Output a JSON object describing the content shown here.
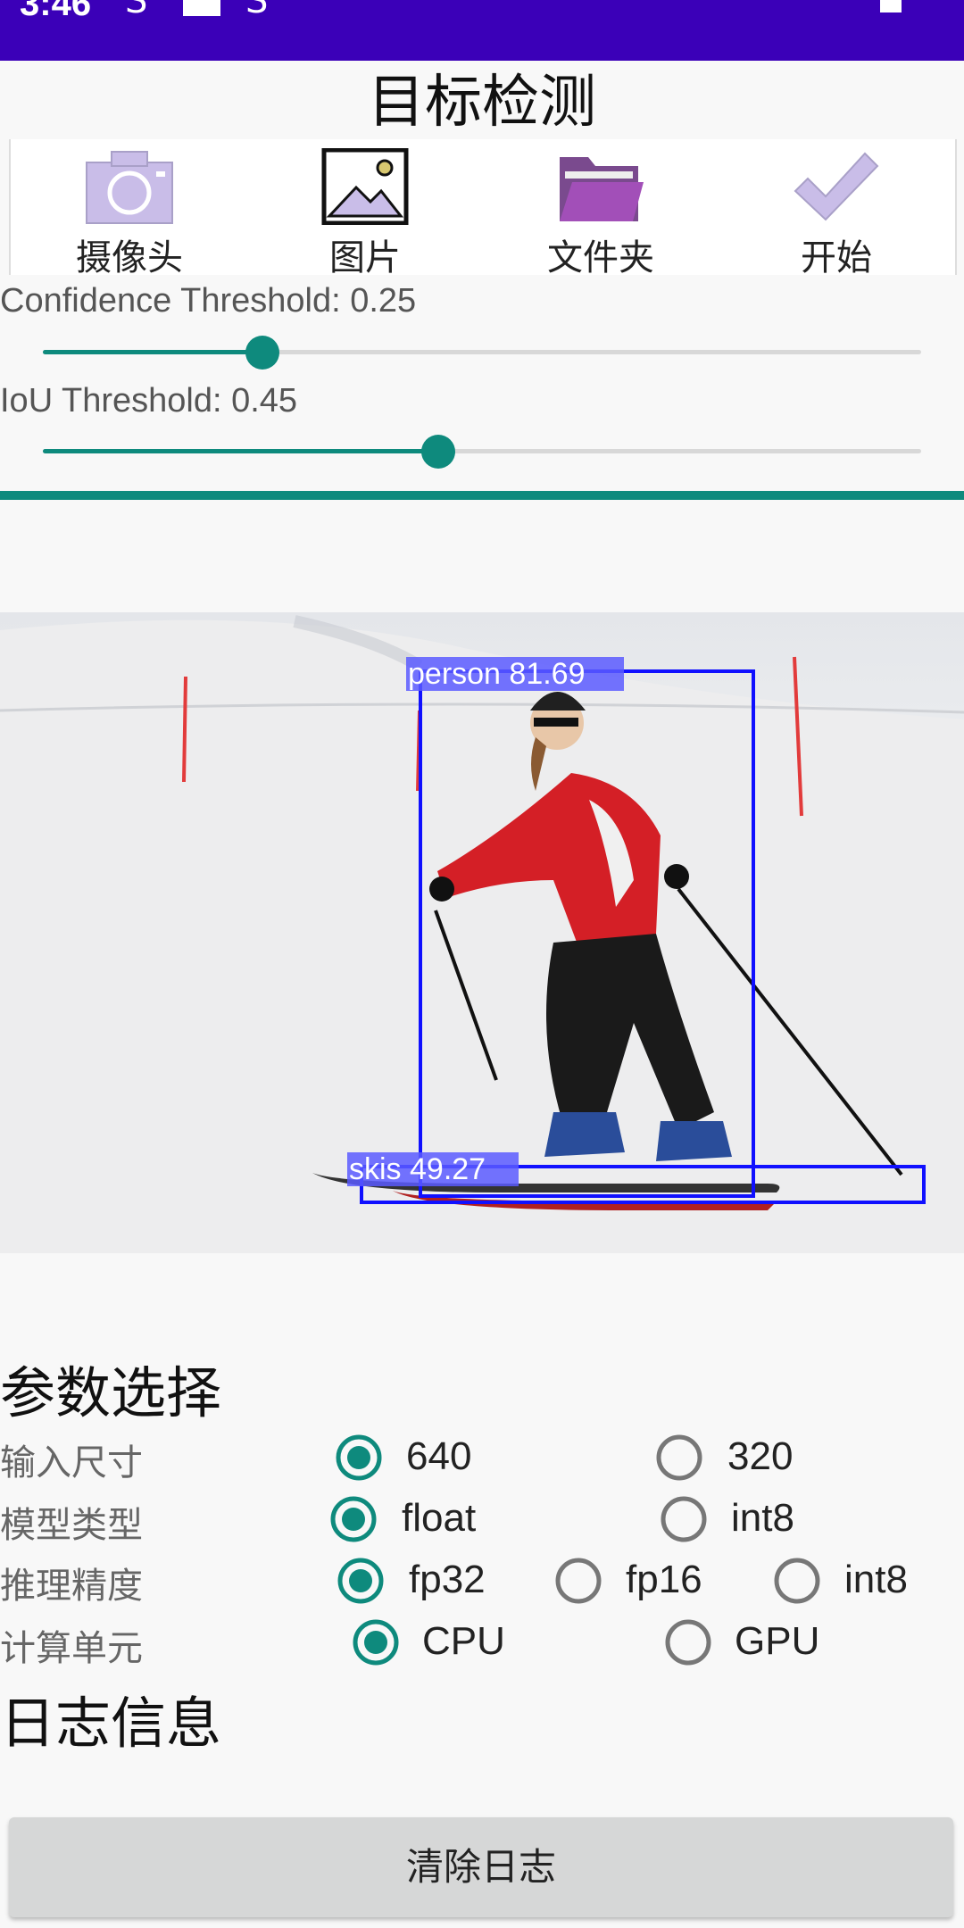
{
  "status_bar": {
    "time": "3:46",
    "icon1": "S",
    "icon2": "S"
  },
  "app": {
    "title": "目标检测"
  },
  "toolbar": {
    "camera_label": "摄像头",
    "image_label": "图片",
    "folder_label": "文件夹",
    "start_label": "开始"
  },
  "sliders": {
    "confidence_label": "Confidence Threshold: 0.25",
    "confidence_value": 0.25,
    "iou_label": "IoU Threshold: 0.45",
    "iou_value": 0.45
  },
  "progress_value": 1.0,
  "detections": {
    "person_label": "person 81.69",
    "skis_label": "skis 49.27"
  },
  "params": {
    "heading": "参数选择",
    "input_size_label": "输入尺寸",
    "input_size_options": [
      "640",
      "320"
    ],
    "input_size_selected": "640",
    "model_type_label": "模型类型",
    "model_type_options": [
      "float",
      "int8"
    ],
    "model_type_selected": "float",
    "precision_label": "推理精度",
    "precision_options": [
      "fp32",
      "fp16",
      "int8"
    ],
    "precision_selected": "fp32",
    "compute_label": "计算单元",
    "compute_options": [
      "CPU",
      "GPU"
    ],
    "compute_selected": "CPU"
  },
  "log": {
    "heading": "日志信息",
    "clear_button": "清除日志"
  },
  "colors": {
    "status_bar": "#3b00b8",
    "accent": "#0e8a7d",
    "detection_box": "#1010ff",
    "icon_fill": "#c9bde8"
  }
}
